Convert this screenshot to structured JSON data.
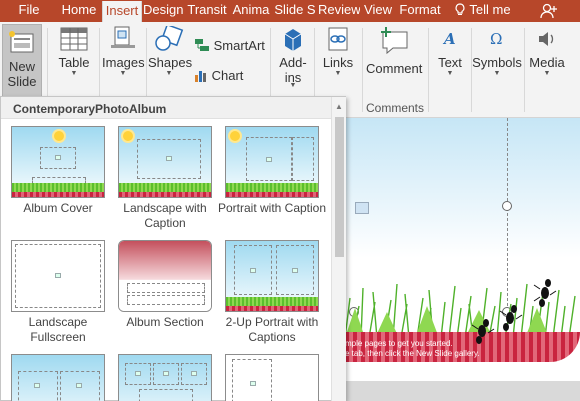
{
  "tabs": [
    {
      "label": "File"
    },
    {
      "label": "Home"
    },
    {
      "label": "Insert"
    },
    {
      "label": "Design"
    },
    {
      "label": "Transit"
    },
    {
      "label": "Anima"
    },
    {
      "label": "Slide S"
    },
    {
      "label": "Review"
    },
    {
      "label": "View"
    },
    {
      "label": "Format"
    },
    {
      "label": "Tell me"
    }
  ],
  "active_tab": "Insert",
  "ribbon": {
    "new_slide": "New Slide",
    "table": "Table",
    "images": "Images",
    "shapes": "Shapes",
    "smartart": "SmartArt",
    "chart": "Chart",
    "addins": "Add-ins",
    "links": "Links",
    "comment": "Comment",
    "comments_group": "Comments",
    "text": "Text",
    "symbols": "Symbols",
    "media": "Media"
  },
  "gallery": {
    "header": "ContemporaryPhotoAlbum",
    "layouts": [
      {
        "label": "Album Cover"
      },
      {
        "label": "Landscape with Caption"
      },
      {
        "label": "Portrait with Caption"
      },
      {
        "label": "Landscape Fullscreen"
      },
      {
        "label": "Album Section"
      },
      {
        "label": "2-Up Portrait with Captions"
      }
    ]
  },
  "slide": {
    "text_line1": "mple pages to get you started.",
    "text_line2": "e tab, then click the New Slide gallery."
  },
  "colors": {
    "accent": "#b7472a",
    "ribbon_bg": "#f3f3f3",
    "icon_blue": "#2b6fb6"
  }
}
